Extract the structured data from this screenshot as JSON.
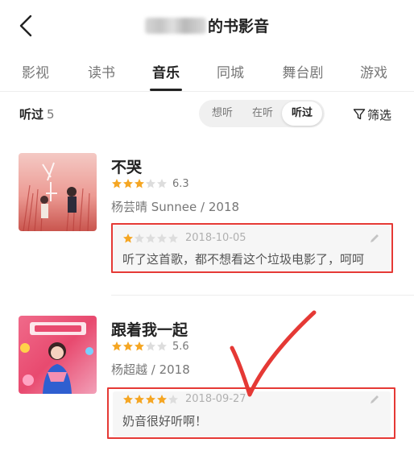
{
  "header": {
    "title_suffix": "的书影音",
    "back_icon": "chevron-left-icon"
  },
  "tabs": [
    {
      "label": "影视"
    },
    {
      "label": "读书"
    },
    {
      "label": "音乐"
    },
    {
      "label": "同城"
    },
    {
      "label": "舞台剧"
    },
    {
      "label": "游戏"
    }
  ],
  "active_tab": "音乐",
  "filter_bar": {
    "label": "听过",
    "count": "5",
    "segments": [
      "想听",
      "在听",
      "听过"
    ],
    "active_segment": "听过",
    "filter_label": "筛选",
    "filter_icon": "funnel-icon"
  },
  "items": [
    {
      "title": "不哭",
      "stars": 3,
      "score": "6.3",
      "meta": "杨芸晴 Sunnee / 2018",
      "review": {
        "stars": 1,
        "date": "2018-10-05",
        "text": "听了这首歌，都不想看这个垃圾电影了，呵呵"
      }
    },
    {
      "title": "跟着我一起",
      "stars": 3,
      "score": "5.6",
      "meta": "杨超越 / 2018",
      "review": {
        "stars": 4,
        "date": "2018-09-27",
        "text": "奶音很好听啊！"
      }
    }
  ],
  "colors": {
    "star_active": "#f5a623",
    "star_inactive": "#dddddd",
    "highlight_outline": "#e53935",
    "check_mark": "#e53935"
  },
  "annotation_icon": "check-mark-icon"
}
